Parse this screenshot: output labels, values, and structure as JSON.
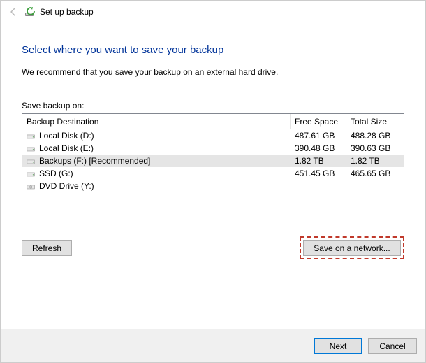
{
  "titlebar": {
    "title": "Set up backup"
  },
  "heading": "Select where you want to save your backup",
  "recommend": "We recommend that you save your backup on an external hard drive.",
  "save_label": "Save backup on:",
  "columns": {
    "dest": "Backup Destination",
    "free": "Free Space",
    "total": "Total Size"
  },
  "rows": [
    {
      "icon": "hdd",
      "name": "Local Disk (D:)",
      "free": "487.61 GB",
      "total": "488.28 GB",
      "selected": false
    },
    {
      "icon": "hdd",
      "name": "Local Disk (E:)",
      "free": "390.48 GB",
      "total": "390.63 GB",
      "selected": false
    },
    {
      "icon": "hdd",
      "name": "Backups (F:) [Recommended]",
      "free": "1.82 TB",
      "total": "1.82 TB",
      "selected": true
    },
    {
      "icon": "hdd",
      "name": "SSD (G:)",
      "free": "451.45 GB",
      "total": "465.65 GB",
      "selected": false
    },
    {
      "icon": "dvd",
      "name": "DVD Drive (Y:)",
      "free": "",
      "total": "",
      "selected": false
    }
  ],
  "buttons": {
    "refresh": "Refresh",
    "save_network": "Save on a network...",
    "next": "Next",
    "cancel": "Cancel"
  }
}
